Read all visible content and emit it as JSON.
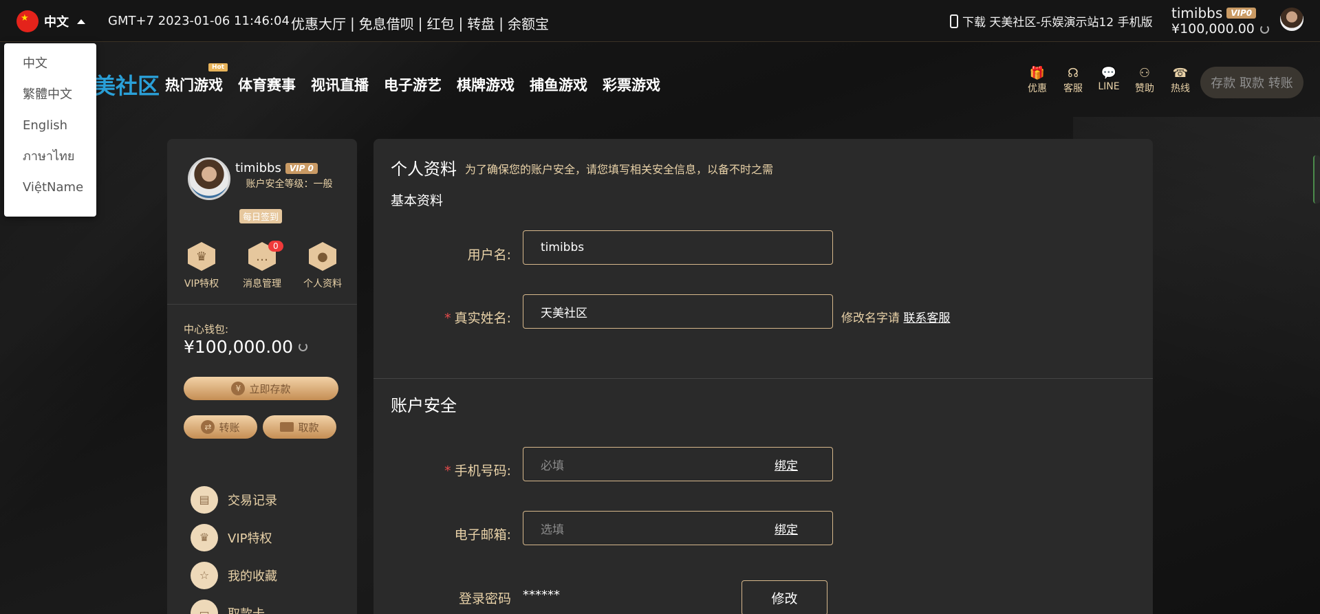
{
  "topbar": {
    "lang_current": "中文",
    "datetime": "GMT+7 2023-01-06 11:46:04",
    "links": [
      "优惠大厅",
      "免息借呗",
      "红包",
      "转盘",
      "余额宝"
    ],
    "download": "下载 天美社区-乐娱演示站12 手机版",
    "username": "timibbs",
    "vip_label": "VIP0",
    "balance": "¥100,000.00"
  },
  "lang_menu": [
    "中文",
    "繁體中文",
    "English",
    "ภาษาไทย",
    "ViệtName"
  ],
  "nav": {
    "logo": "美社区",
    "hot_tag": "Hot",
    "menu": [
      "热门游戏",
      "体育赛事",
      "视讯直播",
      "电子游艺",
      "棋牌游戏",
      "捕鱼游戏",
      "彩票游戏"
    ],
    "icons": [
      {
        "label": "优惠",
        "icon": "gift-icon"
      },
      {
        "label": "客服",
        "icon": "headset-icon"
      },
      {
        "label": "LINE",
        "icon": "line-icon"
      },
      {
        "label": "赞助",
        "icon": "users-icon"
      },
      {
        "label": "热线",
        "icon": "phone-icon"
      }
    ],
    "cash_button": "存款 取款 转账"
  },
  "left": {
    "username": "timibbs",
    "vip_label": "VIP 0",
    "security_level": "账户安全等级：一般",
    "checkin": "每日签到",
    "quick": [
      {
        "label": "VIP特权",
        "icon": "crown-icon"
      },
      {
        "label": "消息管理",
        "icon": "message-icon",
        "badge": "0"
      },
      {
        "label": "个人资料",
        "icon": "profile-icon"
      }
    ],
    "wallet_label": "中心钱包:",
    "wallet_value": "¥100,000.00",
    "deposit_btn": "立即存款",
    "transfer_btn": "转账",
    "withdraw_btn": "取款",
    "menu": [
      {
        "label": "交易记录",
        "icon": "clipboard-icon"
      },
      {
        "label": "VIP特权",
        "icon": "crown-icon"
      },
      {
        "label": "我的收藏",
        "icon": "star-icon"
      },
      {
        "label": "取款卡",
        "icon": "card-icon"
      }
    ]
  },
  "right": {
    "title": "个人资料",
    "subtitle": "为了确保您的账户安全，请您填写相关安全信息，以备不时之需",
    "basic_title": "基本资料",
    "username_label": "用户名:",
    "username_value": "timibbs",
    "realname_label": "真实姓名:",
    "realname_value": "天美社区",
    "realname_note": "修改名字请",
    "realname_link": "联系客服",
    "security_title": "账户安全",
    "phone_label": "手机号码:",
    "phone_placeholder": "必填",
    "bind_label": "绑定",
    "email_label": "电子邮箱:",
    "email_placeholder": "选填",
    "password_label": "登录密码",
    "password_value": "******",
    "edit_label": "修改"
  },
  "colors": {
    "gold": "#e9d2a8",
    "panel": "#2a2a2a",
    "logo_blue": "#2aa0d8",
    "badge_red": "#f03a3a"
  }
}
